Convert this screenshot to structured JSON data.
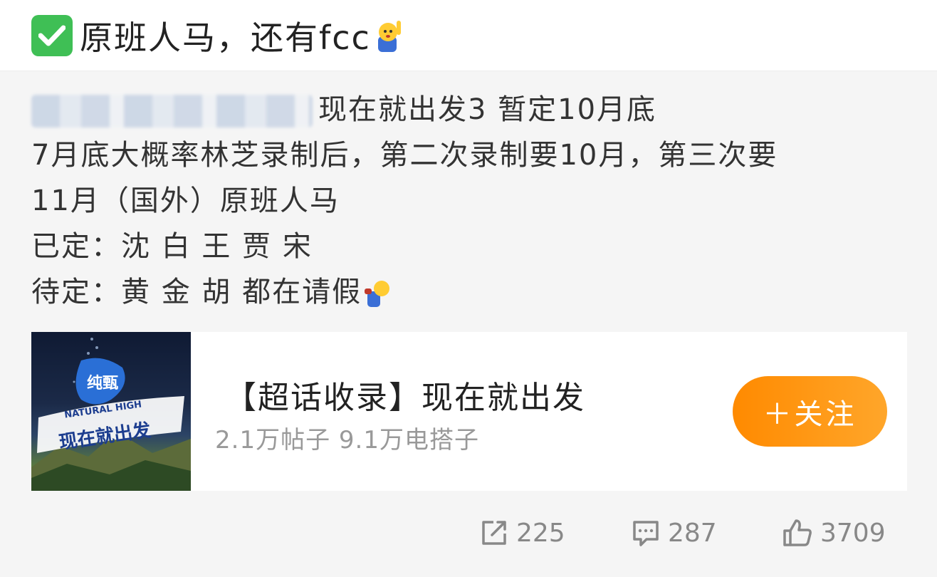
{
  "header": {
    "title": "原班人马，还有fcc"
  },
  "post": {
    "line1_text": "现在就出发3 暂定10月底",
    "line2": "7月底大概率林芝录制后，第二次录制要10月，第三次要",
    "line3": "11月（国外）原班人马",
    "line4": "已定：沈 白 王 贾 宋",
    "line5": "待定：黄 金 胡 都在请假"
  },
  "card": {
    "thumb_logo": "纯甄",
    "thumb_brand": "NATURAL HIGH",
    "thumb_show": "现在就出发",
    "title": "【超话收录】现在就出发",
    "subtitle": "2.1万帖子 9.1万电搭子",
    "follow_label": "＋关注"
  },
  "actions": {
    "repost_count": "225",
    "comment_count": "287",
    "like_count": "3709"
  },
  "colors": {
    "accent": "#ff8a00",
    "check_green": "#3fbf55",
    "muted": "#888888"
  }
}
